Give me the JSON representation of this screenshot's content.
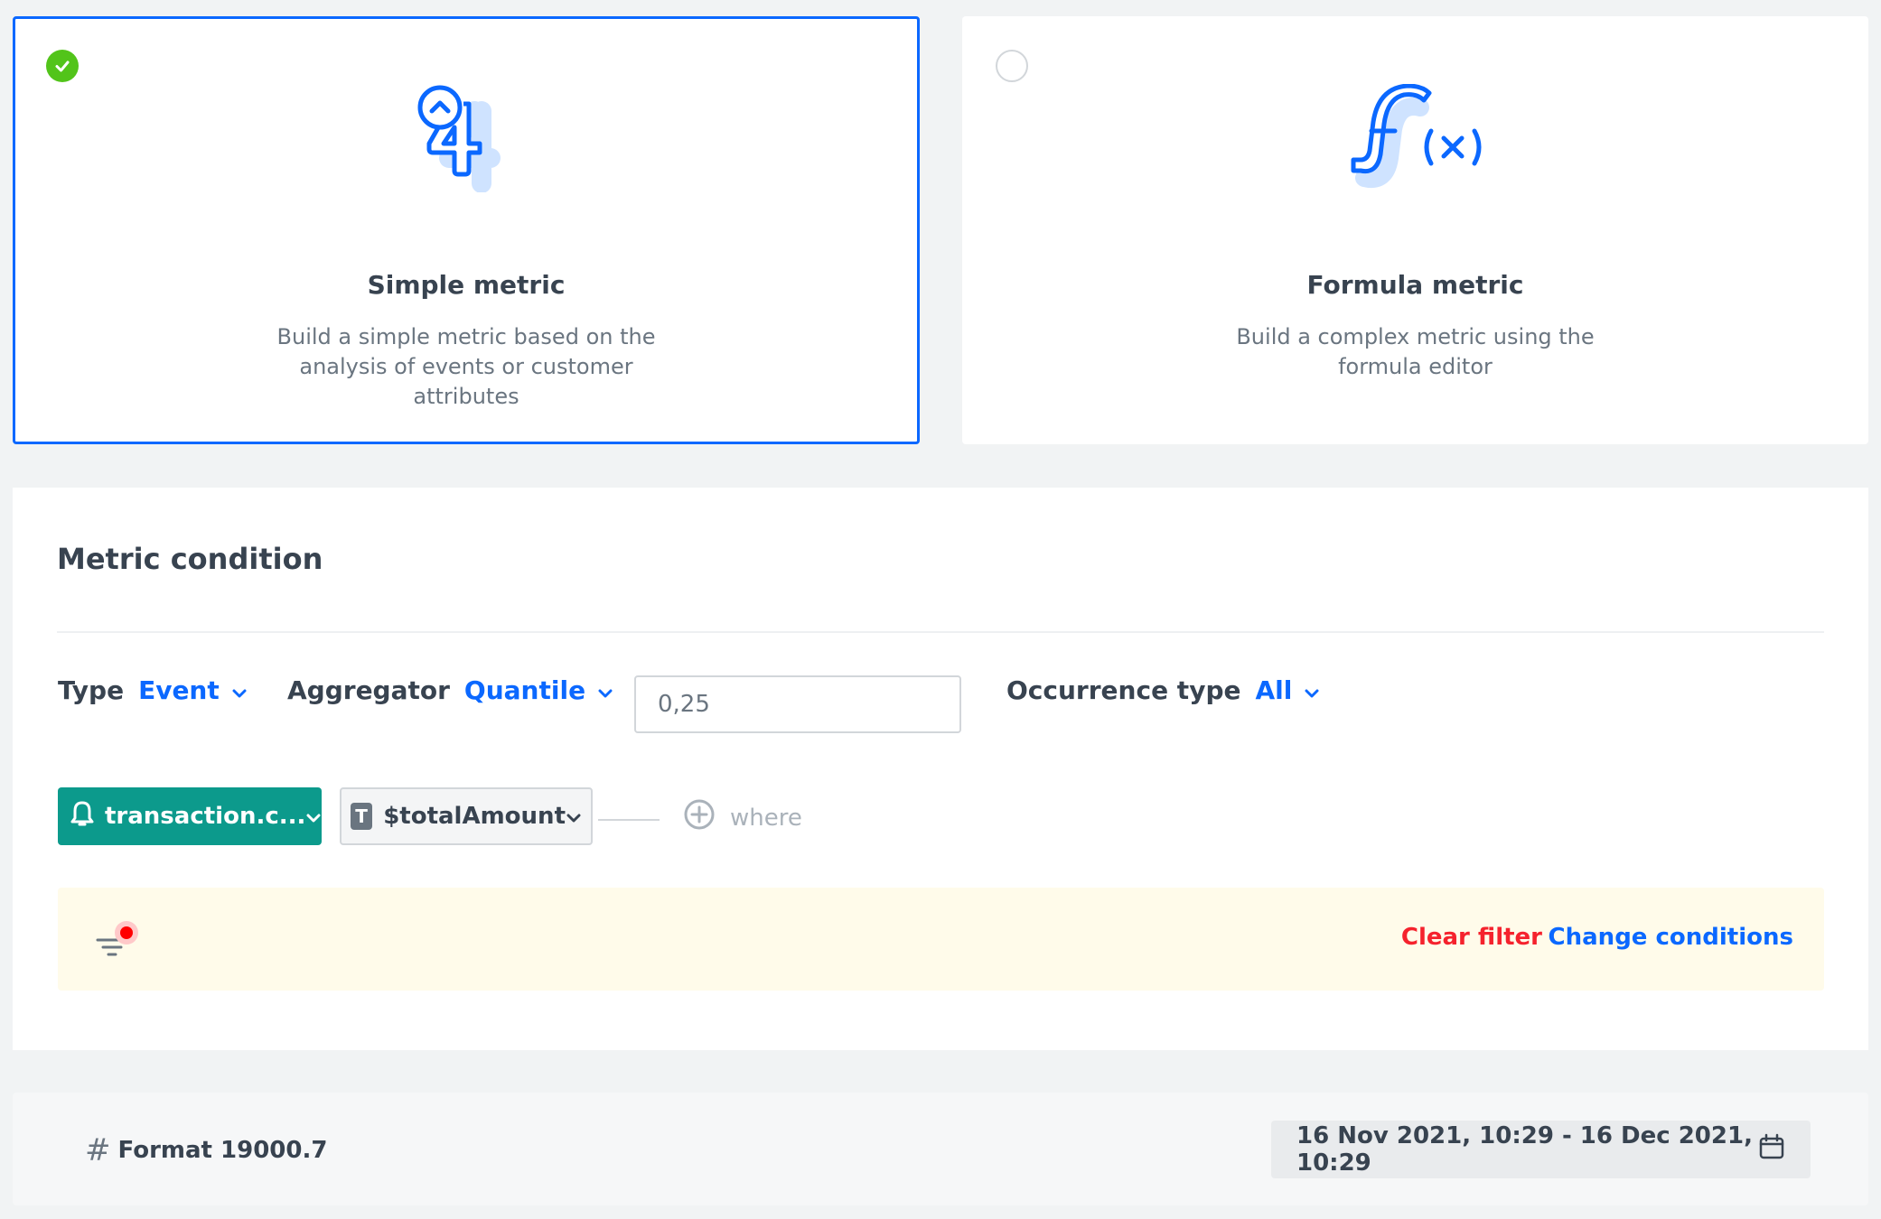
{
  "metric_types": {
    "simple": {
      "title": "Simple metric",
      "description": "Build a simple metric based on the analysis of events or customer attributes",
      "selected": true
    },
    "formula": {
      "title": "Formula metric",
      "description": "Build a complex metric using the formula editor",
      "selected": false
    }
  },
  "condition": {
    "title": "Metric condition",
    "type_label": "Type",
    "type_value": "Event",
    "aggregator_label": "Aggregator",
    "aggregator_value": "Quantile",
    "quantile_value": "0,25",
    "occurrence_label": "Occurrence type",
    "occurrence_value": "All",
    "event_name": "transaction.c...",
    "parameter": "$totalAmount",
    "parameter_tag": "T",
    "where_label": "where",
    "clear_filter": "Clear filter",
    "change_conditions": "Change conditions"
  },
  "footer": {
    "format_label": "Format 19000.7",
    "date_range": "16 Nov 2021, 10:29 - 16 Dec 2021, 10:29"
  },
  "colors": {
    "accent": "#0b68ff",
    "success": "#52c41a",
    "event": "#0c9a8c",
    "danger": "#f5222d",
    "warning_bg": "#fffbea"
  }
}
